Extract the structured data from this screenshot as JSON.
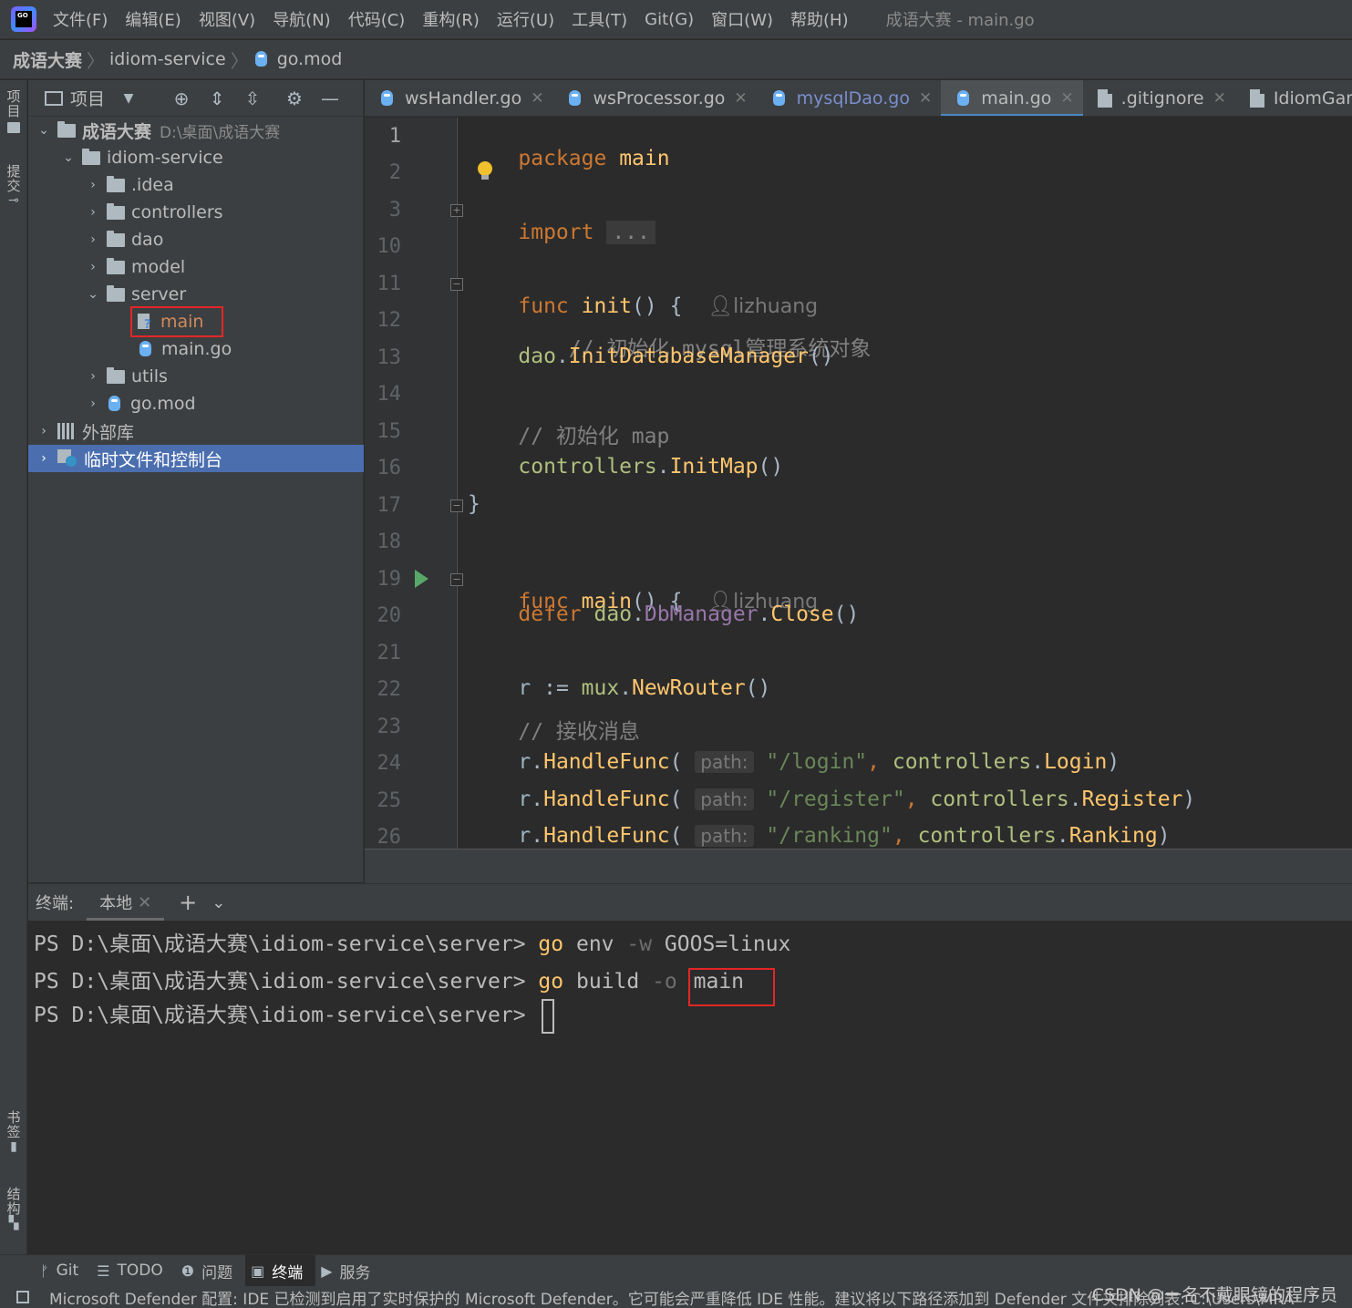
{
  "app": {
    "logo_text": "GO",
    "window_title": "成语大赛 - main.go"
  },
  "menu": [
    "文件(F)",
    "编辑(E)",
    "视图(V)",
    "导航(N)",
    "代码(C)",
    "重构(R)",
    "运行(U)",
    "工具(T)",
    "Git(G)",
    "窗口(W)",
    "帮助(H)"
  ],
  "breadcrumb": [
    "成语大赛",
    "idiom-service",
    "go.mod"
  ],
  "left_stripe": {
    "project": "项目",
    "commit": "提交",
    "bookmarks": "书签",
    "structure": "结构"
  },
  "project_panel": {
    "title": "项目",
    "tree": [
      {
        "label": "成语大赛",
        "hint": "D:\\桌面\\成语大赛",
        "icon": "folder-icon",
        "expanded": true
      },
      {
        "label": "idiom-service",
        "icon": "folder-icon",
        "expanded": true
      },
      {
        "label": ".idea",
        "icon": "folder-icon"
      },
      {
        "label": "controllers",
        "icon": "folder-icon"
      },
      {
        "label": "dao",
        "icon": "folder-icon"
      },
      {
        "label": "model",
        "icon": "folder-icon"
      },
      {
        "label": "server",
        "icon": "folder-icon",
        "expanded": true
      },
      {
        "label": "main",
        "icon": "unknown-file-icon",
        "highlighted": true
      },
      {
        "label": "main.go",
        "icon": "go-file-icon"
      },
      {
        "label": "utils",
        "icon": "folder-icon"
      },
      {
        "label": "go.mod",
        "icon": "go-mod-icon"
      },
      {
        "label": "外部库",
        "icon": "library-icon"
      },
      {
        "label": "临时文件和控制台",
        "icon": "scratch-icon",
        "selected": true
      }
    ]
  },
  "tabs": [
    {
      "label": "wsHandler.go",
      "icon": "go-file-icon"
    },
    {
      "label": "wsProcessor.go",
      "icon": "go-file-icon"
    },
    {
      "label": "mysqlDao.go",
      "icon": "go-file-icon",
      "modified": true
    },
    {
      "label": "main.go",
      "icon": "go-file-icon",
      "active": true
    },
    {
      "label": ".gitignore",
      "icon": "gitignore-icon"
    },
    {
      "label": "IdiomGames.im",
      "icon": "file-icon"
    }
  ],
  "editor": {
    "line_numbers": [
      "1",
      "2",
      "3",
      "10",
      "11",
      "12",
      "13",
      "14",
      "15",
      "16",
      "17",
      "18",
      "19",
      "20",
      "21",
      "22",
      "23",
      "24",
      "25",
      "26"
    ],
    "code": {
      "l1_kw": "package",
      "l1_name": "main",
      "l3_kw": "import",
      "l3_folded": "...",
      "l11_kw": "func",
      "l11_fn": "init",
      "l11_rest": "() {",
      "l11_author": "lizhuang",
      "l12": "// 初始化 mysql管理系统对象",
      "l13_pkg": "dao",
      "l13_call": "InitDatabaseManager",
      "l13_rest": "()",
      "l15": "// 初始化 map",
      "l16_pkg": "controllers",
      "l16_call": "InitMap",
      "l16_rest": "()",
      "l17": "}",
      "l19_kw": "func",
      "l19_fn": "main",
      "l19_rest": "() {",
      "l19_author": "lizhuang",
      "l20_kw": "defer",
      "l20_pkg": "dao",
      "l20_field": "DbManager",
      "l20_call": "Close",
      "l20_rest": "()",
      "l22_var": "r",
      "l22_op": " := ",
      "l22_pkg": "mux",
      "l22_call": "NewRouter",
      "l22_rest": "()",
      "l23": "// 接收消息",
      "handle_var": "r",
      "handle_call": "HandleFunc",
      "hint_label": "path:",
      "l24_str": "\"/login\"",
      "l24_pkg": "controllers",
      "l24_fn": "Login",
      "l25_str": "\"/register\"",
      "l25_pkg": "controllers",
      "l25_fn": "Register",
      "l26_str": "\"/ranking\"",
      "l26_pkg": "controllers",
      "l26_fn": "Ranking"
    }
  },
  "terminal": {
    "title": "终端:",
    "tab": "本地",
    "prompt": "PS D:\\桌面\\成语大赛\\idiom-service\\server> ",
    "lines": [
      {
        "cmd": "go",
        "args1": " env ",
        "flag": "-w",
        "args2": " GOOS=linux"
      },
      {
        "cmd": "go",
        "args1": " build ",
        "flag": "-o",
        "args2": " ",
        "highlight": "main"
      }
    ]
  },
  "toolwindows": [
    {
      "label": "Git",
      "icon": "git-branch-icon"
    },
    {
      "label": "TODO",
      "icon": "list-icon"
    },
    {
      "label": "问题",
      "icon": "problems-icon"
    },
    {
      "label": "终端",
      "icon": "terminal-icon",
      "active": true
    },
    {
      "label": "服务",
      "icon": "services-icon"
    }
  ],
  "status": {
    "message": "Microsoft Defender 配置: IDE 已检测到启用了实时保护的 Microsoft Defender。它可能会严重降低 IDE 性能。建议将以下路径添加到 Defender 文件夹排除列表: C:\\Users\\MRA",
    "watermark": "CSDN @一名不戴眼镜的程序员"
  },
  "colors": {
    "keyword": "#cc7832",
    "function": "#ffc66d",
    "comment": "#808080",
    "string": "#6a8759",
    "selection": "#4b6eaf",
    "highlight_box": "#e32626"
  }
}
